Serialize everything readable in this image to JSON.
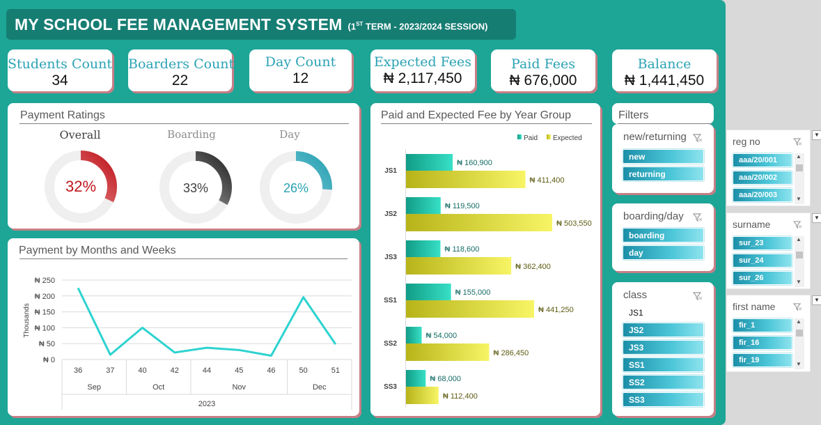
{
  "header": {
    "title": "MY SCHOOL FEE MANAGEMENT SYSTEM",
    "sub_open": "(1",
    "sub_sup": "ST",
    "sub_rest": " TERM - 2023/2024 SESSION)"
  },
  "kpis": [
    {
      "label": "Students Count",
      "value": "34"
    },
    {
      "label": "Boarders Count",
      "value": "22"
    },
    {
      "label": "Day Count",
      "value": "12"
    },
    {
      "label": "Expected Fees",
      "value": "₦ 2,117,450"
    },
    {
      "label": "Paid Fees",
      "value": "₦ 676,000"
    },
    {
      "label": "Balance",
      "value": "₦ 1,441,450"
    }
  ],
  "ratings": {
    "title": "Payment Ratings",
    "gauges": [
      {
        "label": "Overall",
        "percent": 32,
        "text": "32%",
        "color": "#c0161d",
        "label_color": "#404040"
      },
      {
        "label": "Boarding",
        "percent": 33,
        "text": "33%",
        "color": "#3a3a3a",
        "label_color": "#8c8c8c"
      },
      {
        "label": "Day",
        "percent": 26,
        "text": "26%",
        "color": "#2aa2b4",
        "label_color": "#8c8c8c"
      }
    ]
  },
  "months": {
    "title": "Payment by Months and Weeks",
    "yaxis_title": "Thousands",
    "y_ticks": [
      "₦ 250",
      "₦ 200",
      "₦ 150",
      "₦ 100",
      "₦ 50",
      "₦ 0"
    ],
    "weeks": [
      "36",
      "37",
      "40",
      "42",
      "44",
      "45",
      "46",
      "50",
      "51"
    ],
    "months": [
      "Sep",
      "Oct",
      "Nov",
      "Dec"
    ],
    "year": "2023"
  },
  "yeargroup": {
    "title": "Paid and Expected Fee by Year Group",
    "legend_paid": "Paid",
    "legend_expected": "Expected"
  },
  "chart_data": [
    {
      "type": "line",
      "title": "Payment by Months and Weeks",
      "ylabel": "Thousands",
      "x": [
        "36",
        "37",
        "40",
        "42",
        "44",
        "45",
        "46",
        "50",
        "51"
      ],
      "x_groups": [
        {
          "name": "Sep",
          "weeks": [
            "36",
            "37"
          ]
        },
        {
          "name": "Oct",
          "weeks": [
            "40",
            "42"
          ]
        },
        {
          "name": "Nov",
          "weeks": [
            "44",
            "45",
            "46"
          ]
        },
        {
          "name": "Dec",
          "weeks": [
            "50",
            "51"
          ]
        }
      ],
      "values": [
        225,
        15,
        100,
        22,
        37,
        30,
        12,
        196,
        48
      ],
      "ylim": [
        0,
        250
      ],
      "color": "#2cd3d0",
      "grid": true
    },
    {
      "type": "bar",
      "title": "Paid and Expected Fee by Year Group",
      "orientation": "horizontal",
      "categories": [
        "JS1",
        "JS2",
        "JS3",
        "SS1",
        "SS2",
        "SS3"
      ],
      "series": [
        {
          "name": "Paid",
          "values": [
            160900,
            119500,
            118600,
            155000,
            54000,
            68000
          ],
          "labels": [
            "₦ 160,900",
            "₦ 119,500",
            "₦ 118,600",
            "₦ 155,000",
            "₦ 54,000",
            "₦ 68,000"
          ],
          "color": "#18b79a"
        },
        {
          "name": "Expected",
          "values": [
            411400,
            503550,
            362400,
            441250,
            286450,
            112400
          ],
          "labels": [
            "₦ 411,400",
            "₦ 503,550",
            "₦ 362,400",
            "₦ 441,250",
            "₦ 286,450",
            "₦ 112,400"
          ],
          "color": "#e8e43a"
        }
      ],
      "legend": "top-right"
    }
  ],
  "filters": {
    "title": "Filters",
    "newret": {
      "title": "new/returning",
      "items": [
        "new",
        "returning"
      ]
    },
    "boardday": {
      "title": "boarding/day",
      "items": [
        "boarding",
        "day"
      ]
    },
    "class": {
      "title": "class",
      "items": [
        "JS1",
        "JS2",
        "JS3",
        "SS1",
        "SS2",
        "SS3"
      ]
    }
  },
  "side_slicers": {
    "regno": {
      "title": "reg no",
      "items": [
        "aaa/20/001",
        "aaa/20/002",
        "aaa/20/003"
      ]
    },
    "surname": {
      "title": "surname",
      "items": [
        "sur_23",
        "sur_24",
        "sur_26"
      ]
    },
    "firstname": {
      "title": "first name",
      "items": [
        "fir_1",
        "fir_16",
        "fir_19"
      ]
    }
  }
}
